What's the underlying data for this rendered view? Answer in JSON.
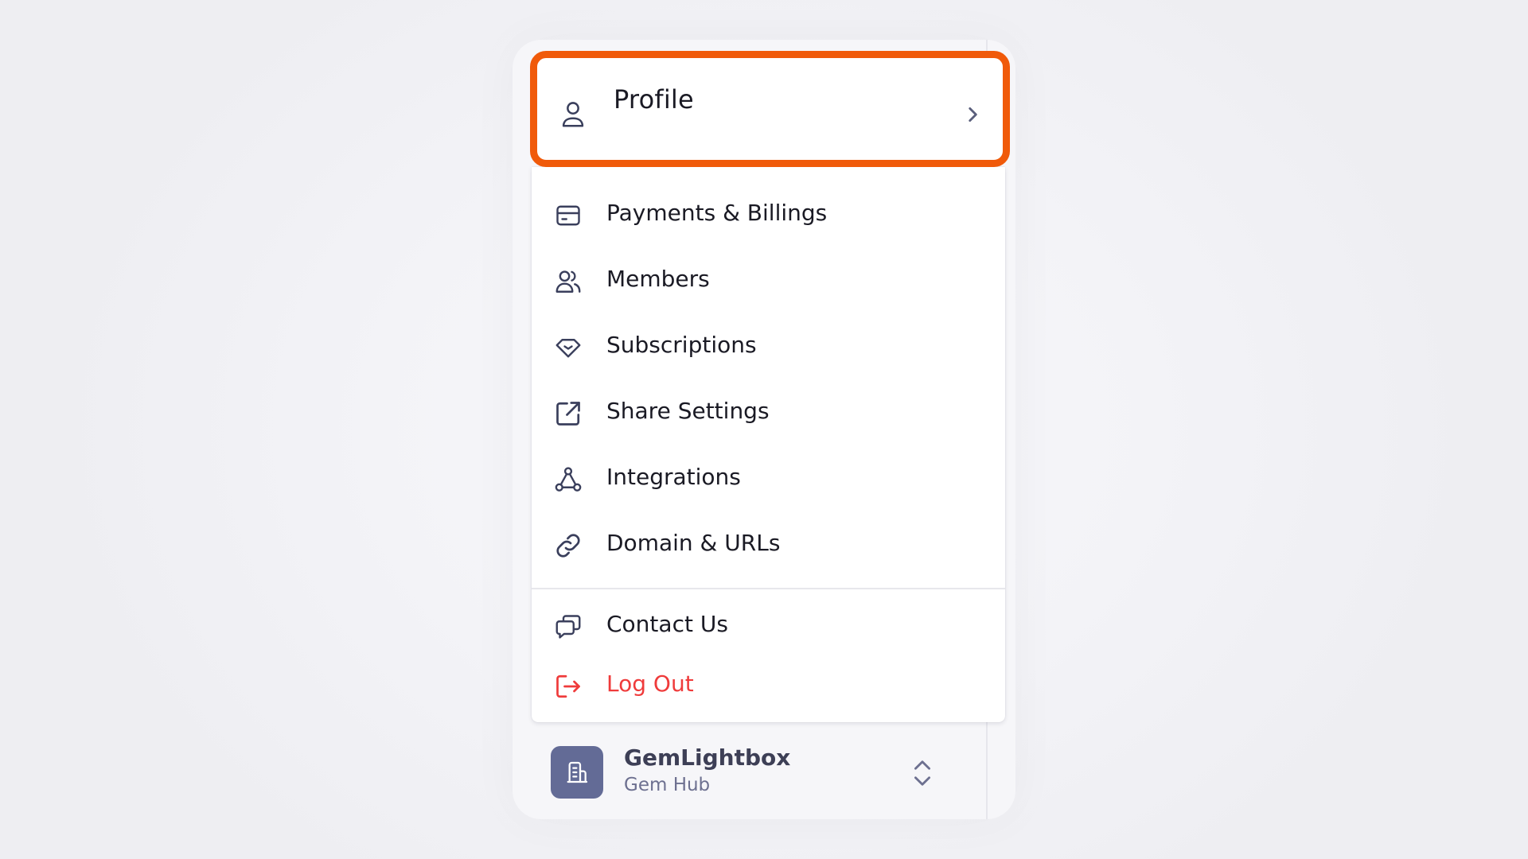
{
  "profile": {
    "label": "Profile",
    "icon": "user-icon",
    "chevron": "chevron-right-icon"
  },
  "menu": {
    "items": [
      {
        "label": "Payments & Billings",
        "icon": "credit-card-icon"
      },
      {
        "label": "Members",
        "icon": "users-icon"
      },
      {
        "label": "Subscriptions",
        "icon": "diamond-icon"
      },
      {
        "label": "Share Settings",
        "icon": "external-link-icon"
      },
      {
        "label": "Integrations",
        "icon": "integration-nodes-icon"
      },
      {
        "label": "Domain & URLs",
        "icon": "link-icon"
      }
    ],
    "footer_items": [
      {
        "label": "Contact Us",
        "icon": "chat-bubbles-icon"
      },
      {
        "label": "Log Out",
        "icon": "logout-icon"
      }
    ]
  },
  "workspace": {
    "name": "GemLightbox",
    "subtitle": "Gem Hub",
    "avatar_icon": "building-icon",
    "switch_icon": "chevron-up-down-icon"
  },
  "colors": {
    "highlight": "#f05a0a",
    "text": "#1a1a24",
    "danger": "#ef3b3b",
    "icon": "#3a3f5c",
    "avatar_bg": "#636b96"
  }
}
